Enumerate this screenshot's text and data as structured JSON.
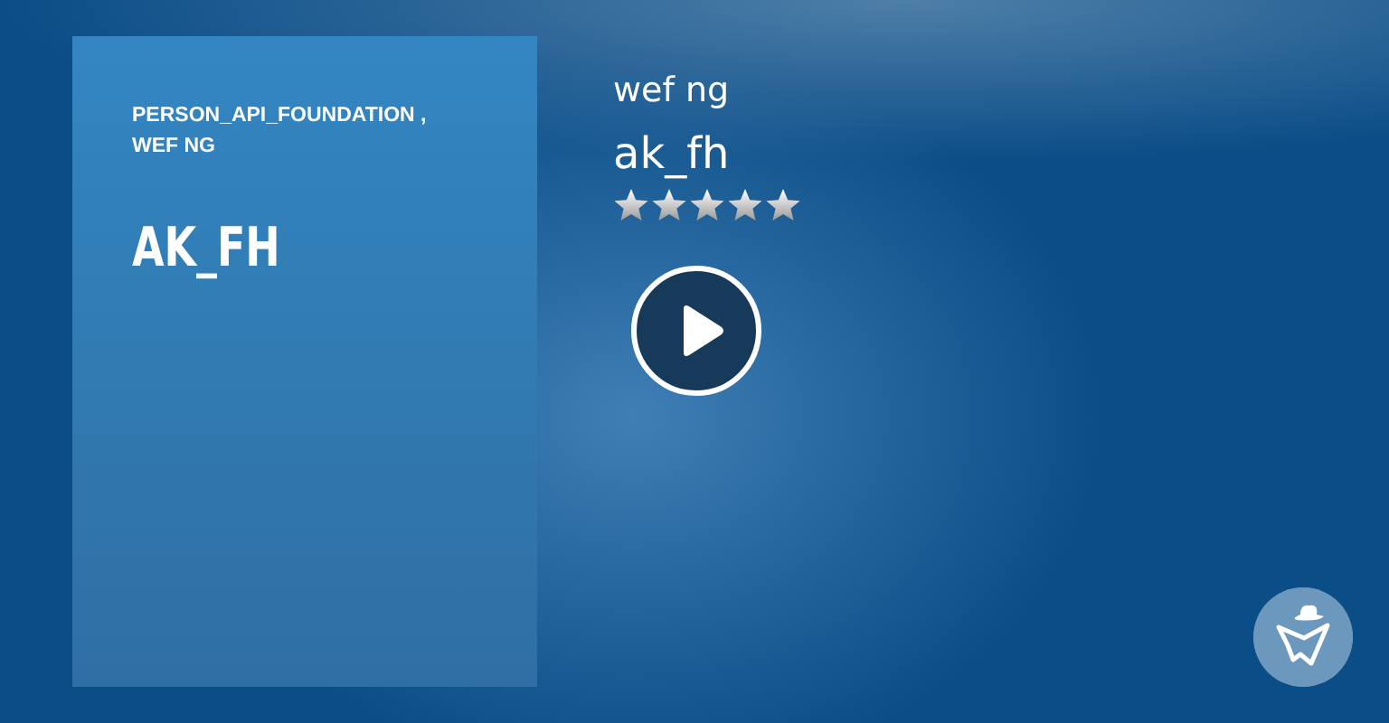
{
  "cover": {
    "authors": "PERSON_API_FOUNDATION , WEF NG",
    "title": "AK_FH"
  },
  "author": "wef ng",
  "title": "ak_fh",
  "rating": {
    "stars": 5
  },
  "player": {
    "playing": false
  }
}
